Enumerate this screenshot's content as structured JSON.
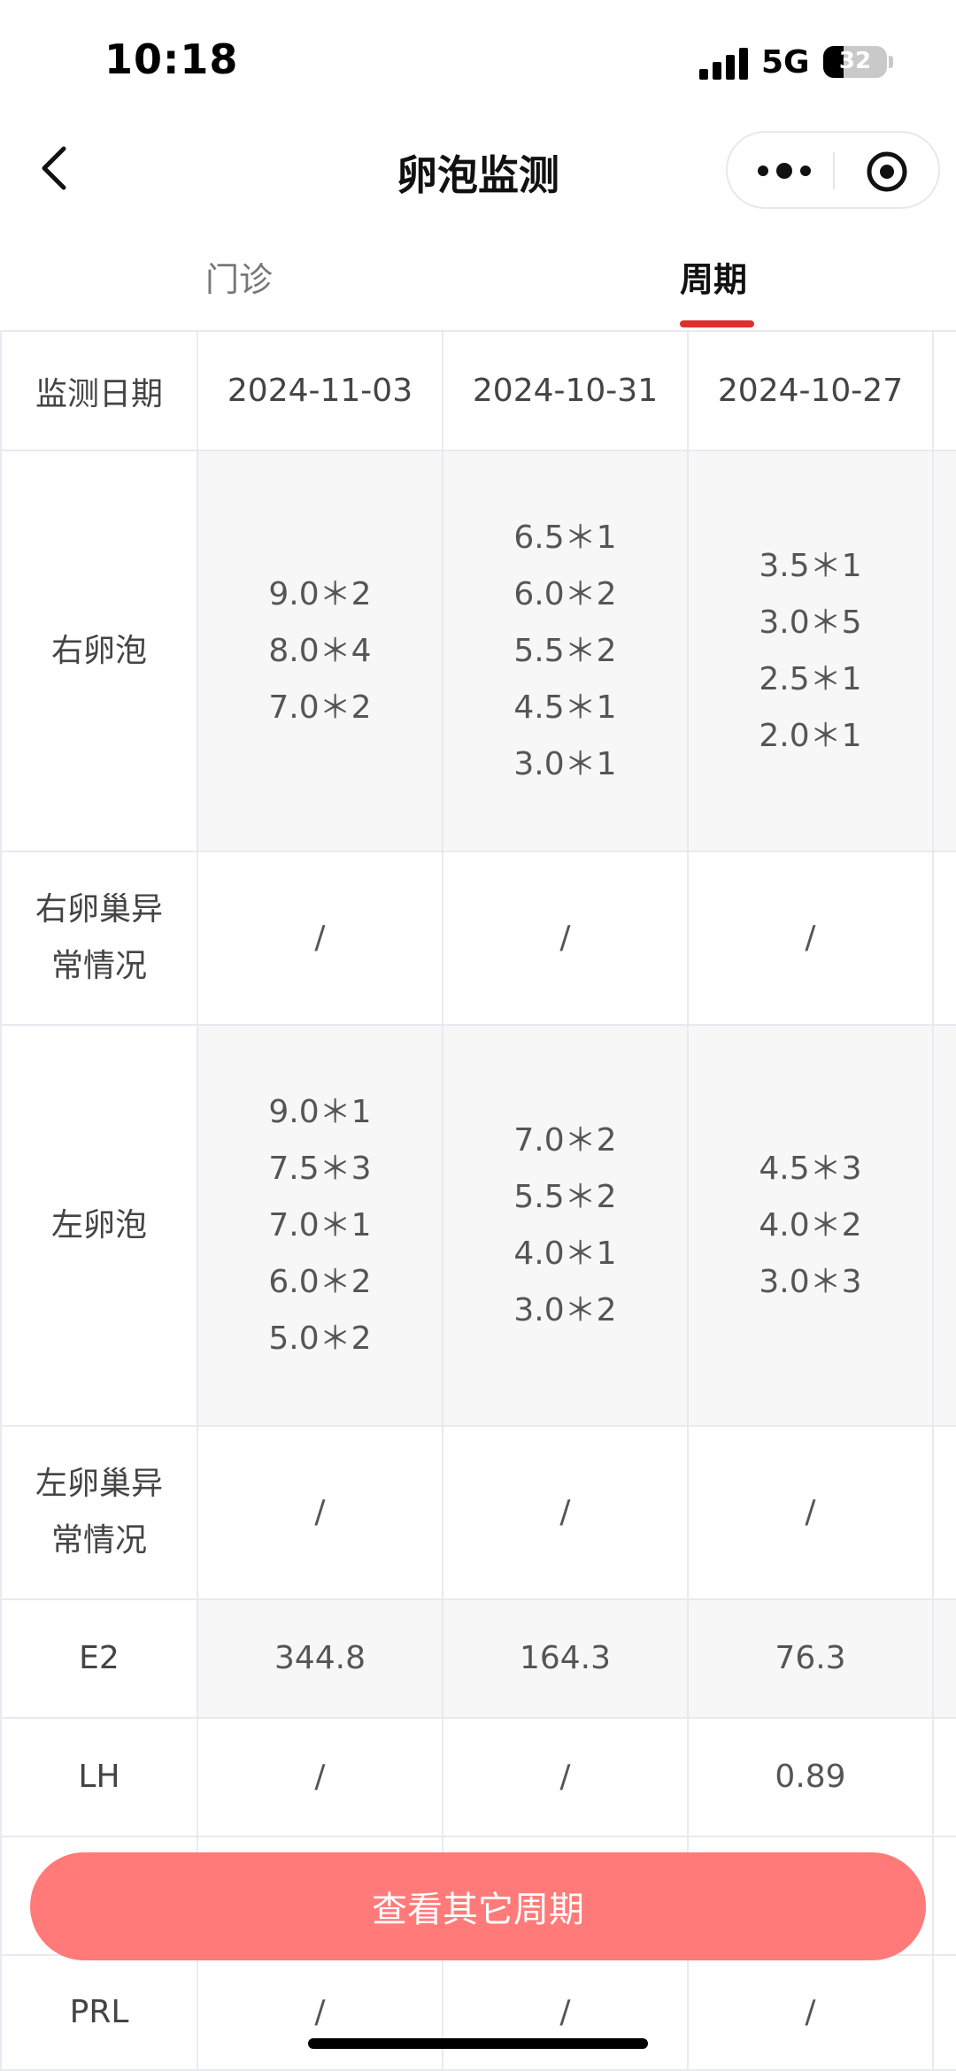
{
  "status_bar": {
    "time": "10:18",
    "network": "5G",
    "battery": "32",
    "battery_level": 0.32
  },
  "nav": {
    "title": "卵泡监测"
  },
  "tabs": [
    {
      "label": "门诊",
      "active": false
    },
    {
      "label": "周期",
      "active": true
    }
  ],
  "table": {
    "header_label": "监测日期",
    "dates": [
      "2024-11-03",
      "2024-10-31",
      "2024-10-27"
    ],
    "rows": [
      {
        "label": [
          "右卵泡"
        ],
        "cells": [
          [
            "9.0＊2",
            "8.0＊4",
            "7.0＊2"
          ],
          [
            "6.5＊1",
            "6.0＊2",
            "5.5＊2",
            "4.5＊1",
            "3.0＊1"
          ],
          [
            "3.5＊1",
            "3.0＊5",
            "2.5＊1",
            "2.0＊1"
          ]
        ]
      },
      {
        "label": [
          "右卵巢异",
          "常情况"
        ],
        "cells": [
          [
            "/"
          ],
          [
            "/"
          ],
          [
            "/"
          ]
        ]
      },
      {
        "label": [
          "左卵泡"
        ],
        "cells": [
          [
            "9.0＊1",
            "7.5＊3",
            "7.0＊1",
            "6.0＊2",
            "5.0＊2"
          ],
          [
            "7.0＊2",
            "5.5＊2",
            "4.0＊1",
            "3.0＊2"
          ],
          [
            "4.5＊3",
            "4.0＊2",
            "3.0＊3"
          ]
        ]
      },
      {
        "label": [
          "左卵巢异",
          "常情况"
        ],
        "cells": [
          [
            "/"
          ],
          [
            "/"
          ],
          [
            "/"
          ]
        ]
      },
      {
        "label": [
          "E2"
        ],
        "cells": [
          [
            "344.8"
          ],
          [
            "164.3"
          ],
          [
            "76.3"
          ]
        ]
      },
      {
        "label": [
          "LH"
        ],
        "cells": [
          [
            "/"
          ],
          [
            "/"
          ],
          [
            "0.89"
          ]
        ]
      },
      {
        "label": [
          ""
        ],
        "cells": [
          [
            ""
          ],
          [
            ""
          ],
          [
            ""
          ]
        ]
      },
      {
        "label": [
          "PRL"
        ],
        "cells": [
          [
            "/"
          ],
          [
            "/"
          ],
          [
            "/"
          ]
        ]
      }
    ]
  },
  "footer": {
    "button_label": "查看其它周期"
  },
  "colors": {
    "accent": "#e02e2e",
    "button": "#ff7a78",
    "row_shade": "#f7f7f8",
    "border": "#e8eaf0"
  }
}
